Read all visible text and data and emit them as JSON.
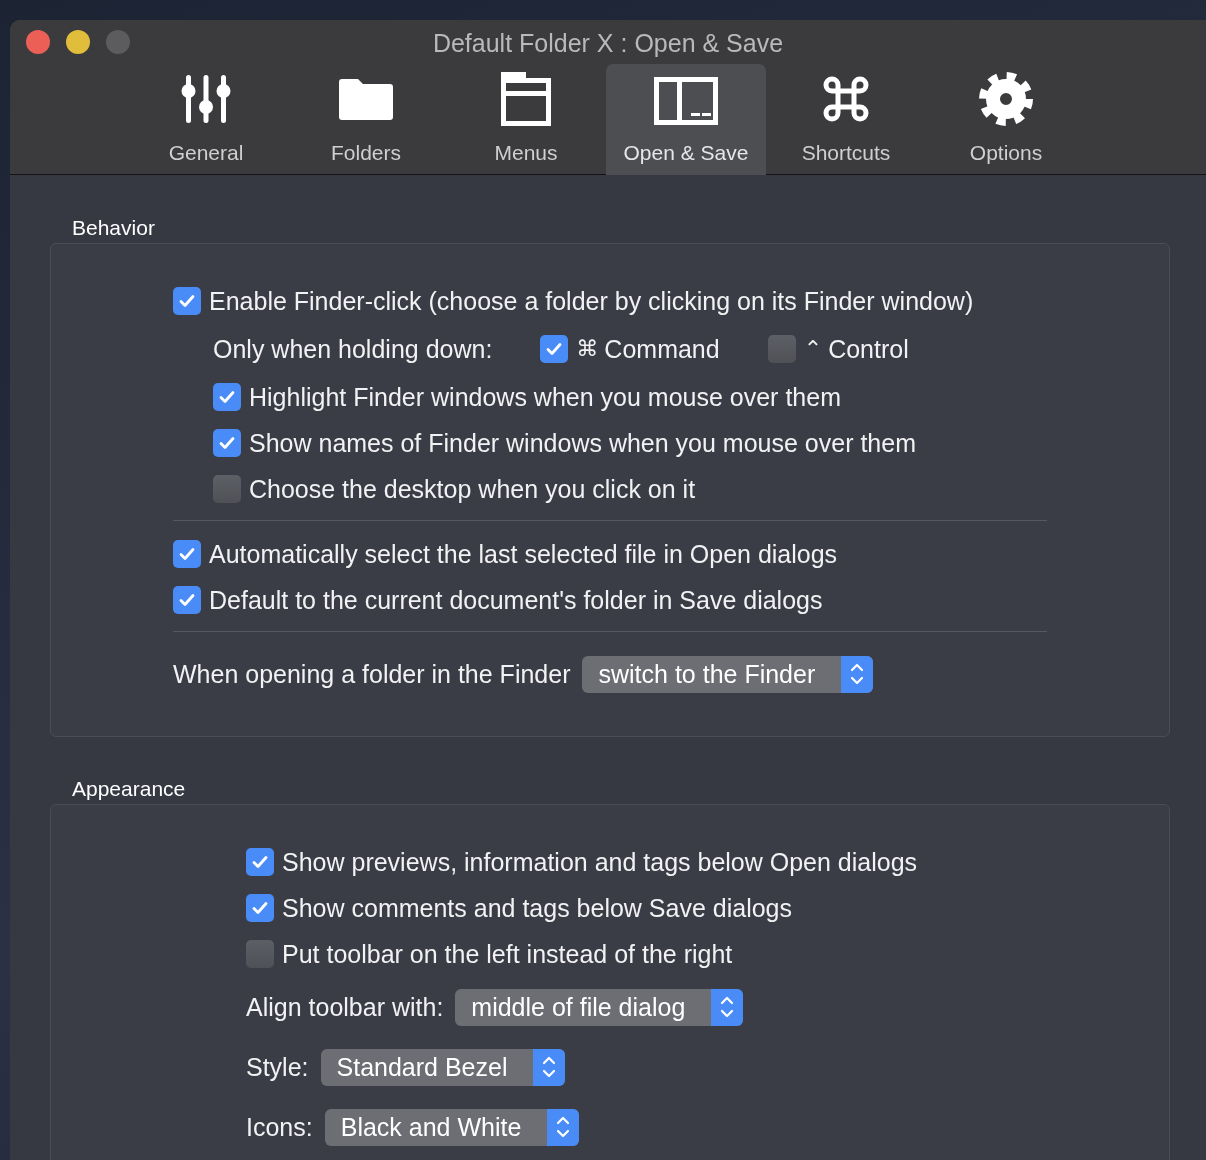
{
  "window": {
    "title": "Default Folder X : Open & Save"
  },
  "tabs": [
    {
      "label": "General",
      "selected": false
    },
    {
      "label": "Folders",
      "selected": false
    },
    {
      "label": "Menus",
      "selected": false
    },
    {
      "label": "Open & Save",
      "selected": true
    },
    {
      "label": "Shortcuts",
      "selected": false
    },
    {
      "label": "Options",
      "selected": false
    }
  ],
  "behavior": {
    "title": "Behavior",
    "groups": [
      [
        {
          "kind": "checkbox",
          "label": "Enable Finder-click (choose a folder by clicking on its Finder window)",
          "checked": true,
          "children": [
            {
              "kind": "modifiers",
              "label": "Only when holding down:",
              "options": [
                {
                  "symbol": "⌘",
                  "label": "Command",
                  "checked": true
                },
                {
                  "symbol": "⌃",
                  "label": "Control",
                  "checked": false
                }
              ]
            },
            {
              "kind": "checkbox",
              "label": "Highlight Finder windows when you mouse over them",
              "checked": true
            },
            {
              "kind": "checkbox",
              "label": "Show names of Finder windows when you mouse over them",
              "checked": true
            },
            {
              "kind": "checkbox",
              "label": "Choose the desktop when you click on it",
              "checked": false
            }
          ]
        }
      ],
      [
        {
          "kind": "checkbox",
          "label": "Automatically select the last selected file in Open dialogs",
          "checked": true
        },
        {
          "kind": "checkbox",
          "label": "Default to the current document's folder in Save dialogs",
          "checked": true
        }
      ],
      [
        {
          "kind": "popup",
          "label": "When opening a folder in the Finder",
          "value": "switch to the Finder"
        }
      ]
    ]
  },
  "appearance": {
    "title": "Appearance",
    "items": [
      {
        "kind": "checkbox",
        "label": "Show previews, information and tags below Open dialogs",
        "checked": true
      },
      {
        "kind": "checkbox",
        "label": "Show comments and tags below Save dialogs",
        "checked": true
      },
      {
        "kind": "checkbox",
        "label": "Put toolbar on the left instead of the right",
        "checked": false
      },
      {
        "kind": "popup",
        "label": "Align toolbar with:",
        "value": "middle of file dialog"
      },
      {
        "kind": "popup",
        "label": "Style:",
        "value": "Standard Bezel"
      },
      {
        "kind": "popup",
        "label": "Icons:",
        "value": "Black and White"
      }
    ]
  }
}
